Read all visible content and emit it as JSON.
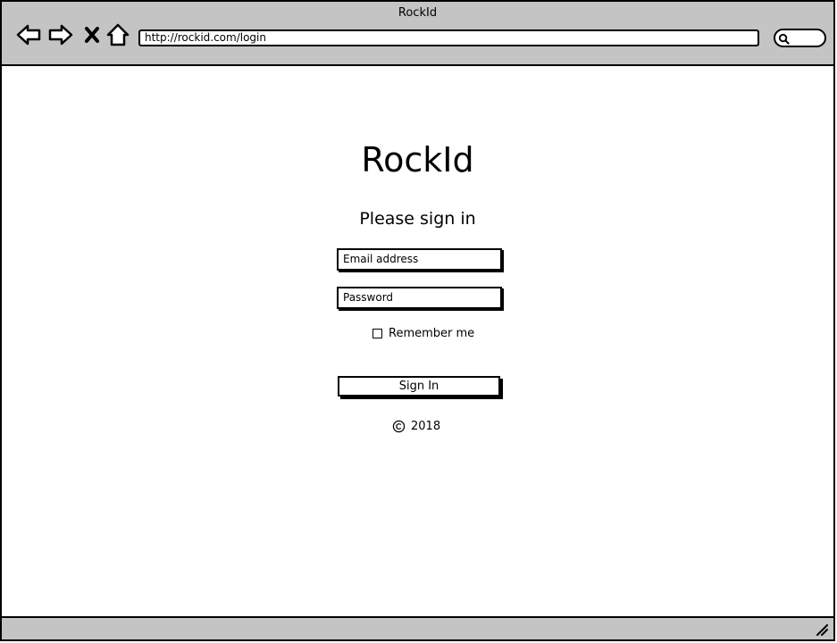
{
  "window": {
    "title": "RockId"
  },
  "toolbar": {
    "back_icon": "back-arrow-icon",
    "forward_icon": "forward-arrow-icon",
    "stop_icon": "close-icon",
    "home_icon": "home-icon",
    "url": "http://rockid.com/login",
    "search_icon": "search-icon"
  },
  "login": {
    "brand": "RockId",
    "heading": "Please sign in",
    "email_placeholder": "Email address",
    "password_placeholder": "Password",
    "remember_label": "Remember me",
    "remember_checked": false,
    "submit_label": "Sign In",
    "copyright_year": "2018"
  },
  "status": {
    "resize_icon": "resize-grip-icon"
  }
}
